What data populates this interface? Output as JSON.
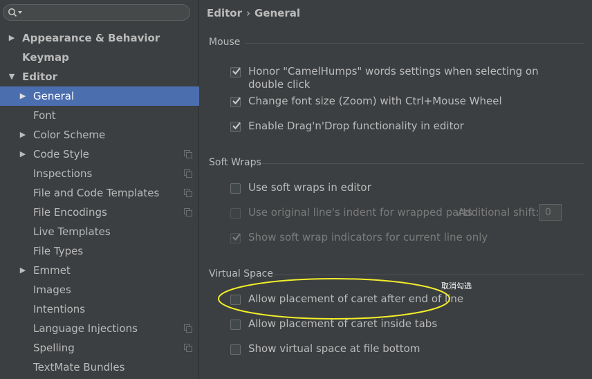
{
  "search": {
    "placeholder": ""
  },
  "sidebar": {
    "items": [
      {
        "label": "Appearance & Behavior",
        "arrow": "▶",
        "bold": true
      },
      {
        "label": "Keymap",
        "arrow": "",
        "bold": true
      },
      {
        "label": "Editor",
        "arrow": "▼",
        "bold": true
      },
      {
        "label": "General",
        "arrow": "▶",
        "selected": true
      },
      {
        "label": "Font",
        "arrow": ""
      },
      {
        "label": "Color Scheme",
        "arrow": "▶"
      },
      {
        "label": "Code Style",
        "arrow": "▶",
        "copy_icon": true
      },
      {
        "label": "Inspections",
        "arrow": "",
        "copy_icon": true
      },
      {
        "label": "File and Code Templates",
        "arrow": "",
        "copy_icon": true
      },
      {
        "label": "File Encodings",
        "arrow": "",
        "copy_icon": true
      },
      {
        "label": "Live Templates",
        "arrow": ""
      },
      {
        "label": "File Types",
        "arrow": ""
      },
      {
        "label": "Emmet",
        "arrow": "▶"
      },
      {
        "label": "Images",
        "arrow": ""
      },
      {
        "label": "Intentions",
        "arrow": ""
      },
      {
        "label": "Language Injections",
        "arrow": "",
        "copy_icon": true
      },
      {
        "label": "Spelling",
        "arrow": "",
        "copy_icon": true
      },
      {
        "label": "TextMate Bundles",
        "arrow": ""
      }
    ]
  },
  "breadcrumb": {
    "parent": "Editor",
    "separator": "›",
    "current": "General"
  },
  "sections": {
    "mouse": {
      "title": "Mouse",
      "options": [
        {
          "label_line1": "Honor \"CamelHumps\" words settings when selecting on",
          "label_line2": "double click",
          "checked": true
        },
        {
          "label": "Change font size (Zoom) with Ctrl+Mouse Wheel",
          "checked": true
        },
        {
          "label": "Enable Drag'n'Drop functionality in editor",
          "checked": true
        }
      ]
    },
    "soft_wraps": {
      "title": "Soft Wraps",
      "options": [
        {
          "label": "Use soft wraps in editor",
          "checked": false,
          "enabled": true
        },
        {
          "label": "Use original line's indent for wrapped parts",
          "checked": false,
          "enabled": false
        },
        {
          "label": "Show soft wrap indicators for current line only",
          "checked": true,
          "enabled": false
        }
      ],
      "additional_shift_label": "Additional shift:",
      "additional_shift_value": "0"
    },
    "virtual_space": {
      "title": "Virtual Space",
      "options": [
        {
          "label": "Allow placement of caret after end of line",
          "checked": false
        },
        {
          "label": "Allow placement of caret inside tabs",
          "checked": false
        },
        {
          "label": "Show virtual space at file bottom",
          "checked": false
        }
      ]
    }
  },
  "annotation": {
    "text": "取消勾选",
    "color": "#f2ef2a"
  },
  "colors": {
    "background": "#3c3f41",
    "selection": "#4b6eaf",
    "text": "#bbbbbb"
  }
}
